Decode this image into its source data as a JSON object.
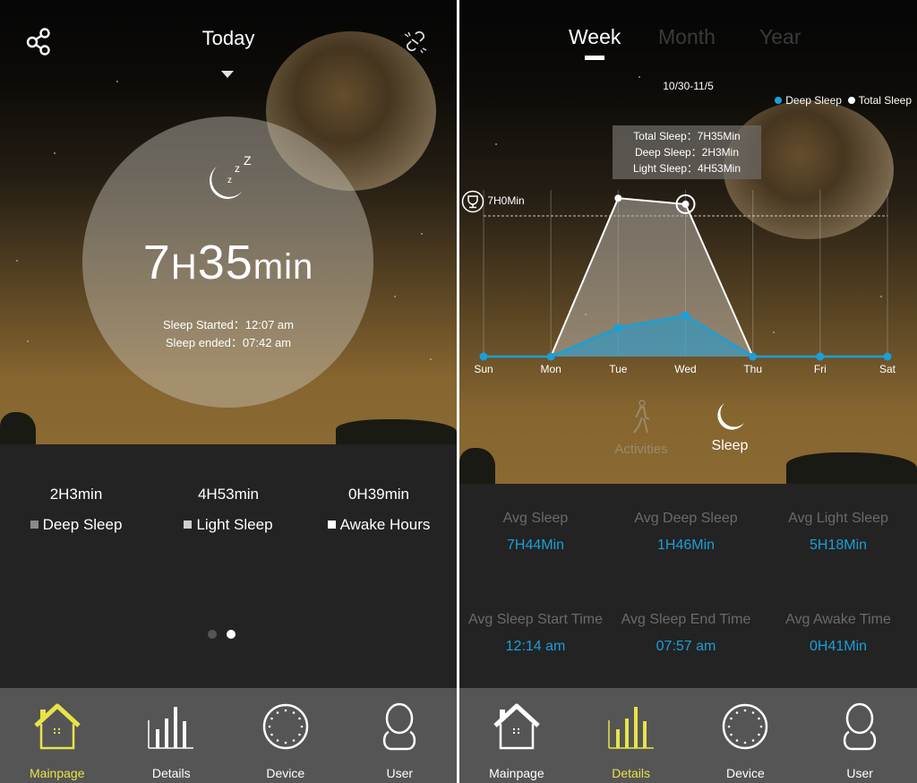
{
  "left": {
    "header": {
      "title": "Today",
      "share_icon": "share-icon",
      "link_icon": "link-sync-icon",
      "dropdown_icon": "triangle-down-icon"
    },
    "summary": {
      "icon": "moon-sleep-icon",
      "hours": "7",
      "hours_unit": "H",
      "minutes": "35",
      "minutes_unit": "min",
      "sleep_started": "Sleep Started：12:07 am",
      "sleep_ended": "Sleep ended：07:42 am"
    },
    "stats": [
      {
        "value": "2H3min",
        "label": "Deep Sleep",
        "color": "#8a8a8a"
      },
      {
        "value": "4H53min",
        "label": "Light Sleep",
        "color": "#d0d0d0"
      },
      {
        "value": "0H39min",
        "label": "Awake Hours",
        "color": "#ffffff"
      }
    ],
    "pager": {
      "pages": 2,
      "active": 2
    },
    "tabbar": [
      {
        "label": "Mainpage",
        "icon": "home-icon",
        "active": true
      },
      {
        "label": "Details",
        "icon": "bar-chart-icon",
        "active": false
      },
      {
        "label": "Device",
        "icon": "watch-dial-icon",
        "active": false
      },
      {
        "label": "User",
        "icon": "user-icon",
        "active": false
      }
    ]
  },
  "right": {
    "tabs": [
      {
        "label": "Week",
        "active": true
      },
      {
        "label": "Month",
        "active": false
      },
      {
        "label": "Year",
        "active": false
      }
    ],
    "date_range": "10/30-11/5",
    "legend": [
      {
        "label": "Deep Sleep",
        "color": "#1a9fd8"
      },
      {
        "label": "Total Sleep",
        "color": "#ffffff"
      }
    ],
    "tooltip": {
      "total": "Total Sleep：7H35Min",
      "deep": "Deep Sleep：2H3Min",
      "light": "Light Sleep：4H53Min"
    },
    "goal_label": "7H0Min",
    "modes": [
      {
        "label": "Activities",
        "icon": "walking-person-icon",
        "active": false
      },
      {
        "label": "Sleep",
        "icon": "moon-icon",
        "active": true
      }
    ],
    "averages": [
      {
        "label": "Avg Sleep",
        "value": "7H44Min"
      },
      {
        "label": "Avg Deep Sleep",
        "value": "1H46Min"
      },
      {
        "label": "Avg Light Sleep",
        "value": "5H18Min"
      },
      {
        "label": "Avg Sleep Start Time",
        "value": "12:14 am"
      },
      {
        "label": "Avg Sleep End Time",
        "value": "07:57 am"
      },
      {
        "label": "Avg Awake Time",
        "value": "0H41Min"
      }
    ],
    "tabbar": [
      {
        "label": "Mainpage",
        "icon": "home-icon",
        "active": false
      },
      {
        "label": "Details",
        "icon": "bar-chart-icon",
        "active": true
      },
      {
        "label": "Device",
        "icon": "watch-dial-icon",
        "active": false
      },
      {
        "label": "User",
        "icon": "user-icon",
        "active": false
      }
    ]
  },
  "chart_data": {
    "type": "area",
    "title": "",
    "categories": [
      "Sun",
      "Mon",
      "Tue",
      "Wed",
      "Thu",
      "Fri",
      "Sat"
    ],
    "series": [
      {
        "name": "Total Sleep",
        "unit": "min",
        "values": [
          0,
          0,
          473,
          455,
          0,
          0,
          0
        ]
      },
      {
        "name": "Deep Sleep",
        "unit": "min",
        "values": [
          0,
          0,
          86,
          123,
          0,
          0,
          0
        ]
      }
    ],
    "goal_line": {
      "label": "7H0Min",
      "value": 420
    },
    "selected_category": "Wed",
    "ylim": [
      0,
      500
    ],
    "grid": "vertical",
    "legend": "top-right"
  }
}
